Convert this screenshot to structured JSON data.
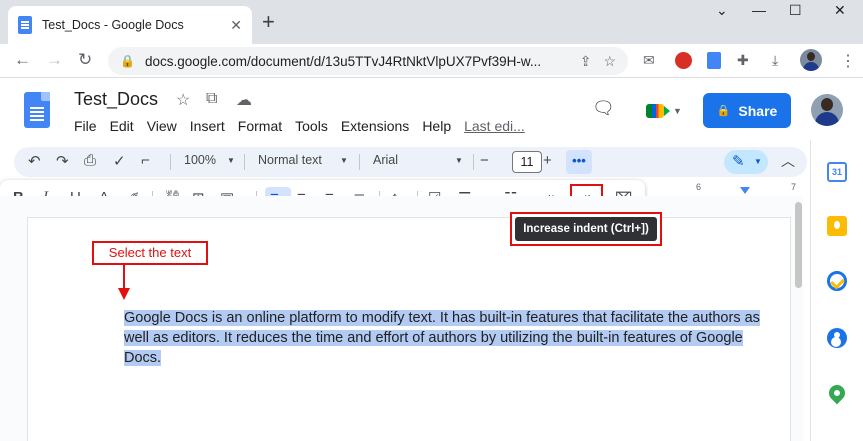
{
  "browser": {
    "tab_title": "Test_Docs - Google Docs",
    "tab_close": "✕",
    "new_tab": "+",
    "url": "docs.google.com/document/d/13u5TTvJ4RtNktVlpUX7Pvf39H-w...",
    "win_chevron": "⌄",
    "win_minimize": "—",
    "win_maximize": "☐",
    "win_close": "✕"
  },
  "docs": {
    "title": "Test_Docs",
    "menu": [
      "File",
      "Edit",
      "View",
      "Insert",
      "Format",
      "Tools",
      "Extensions",
      "Help"
    ],
    "last_edit": "Last edi...",
    "share_label": "Share"
  },
  "toolbar": {
    "zoom": "100%",
    "style": "Normal text",
    "font": "Arial",
    "font_size": "11",
    "minus": "−",
    "plus": "+",
    "more": "•••"
  },
  "toolbar2": {
    "bold": "B",
    "italic": "I",
    "underline": "U",
    "font_color": "A"
  },
  "ruler": {
    "n6": "6",
    "n7": "7"
  },
  "document": {
    "body": "Google Docs is an online platform to modify text. It has built-in features that facilitate the authors as well as editors. It reduces the time and effort of authors by utilizing the built-in features of Google Docs."
  },
  "annotations": {
    "select_text": "Select the text",
    "tooltip": "Increase indent (Ctrl+])",
    "accent_color": "#e01010"
  },
  "side_panel": {
    "calendar_label": "31"
  },
  "colors": {
    "share_blue": "#1a73e8",
    "toolbar_bg": "#edf2fa",
    "selection": "#b3cbf2"
  }
}
